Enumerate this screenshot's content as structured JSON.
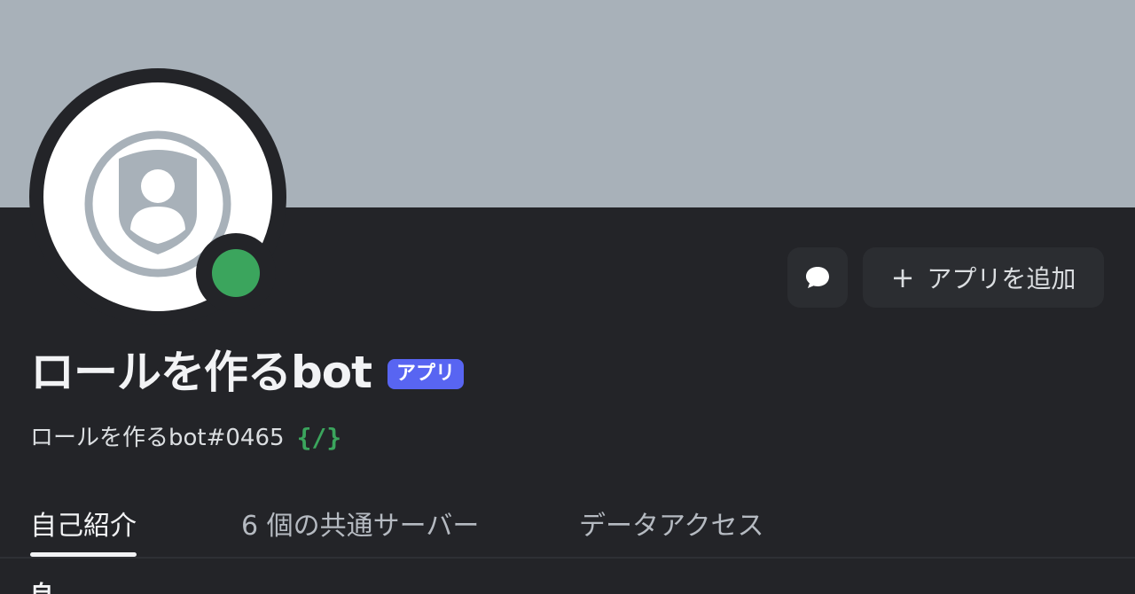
{
  "profile": {
    "display_name": "ロールを作るbot",
    "badge": "アプリ",
    "user_tag": "ロールを作るbot#0465",
    "slash_icon_text": "{/}",
    "status": "online",
    "banner_color": "#a8b1b9",
    "status_color": "#3ba55d"
  },
  "actions": {
    "message_icon": "speech-bubble-icon",
    "add_app_label": "アプリを追加",
    "add_icon": "plus-icon"
  },
  "tabs": [
    {
      "label": "自己紹介",
      "active": true
    },
    {
      "label": "6 個の共通サーバー",
      "active": false
    },
    {
      "label": "データアクセス",
      "active": false
    }
  ],
  "section": {
    "title": "自"
  }
}
